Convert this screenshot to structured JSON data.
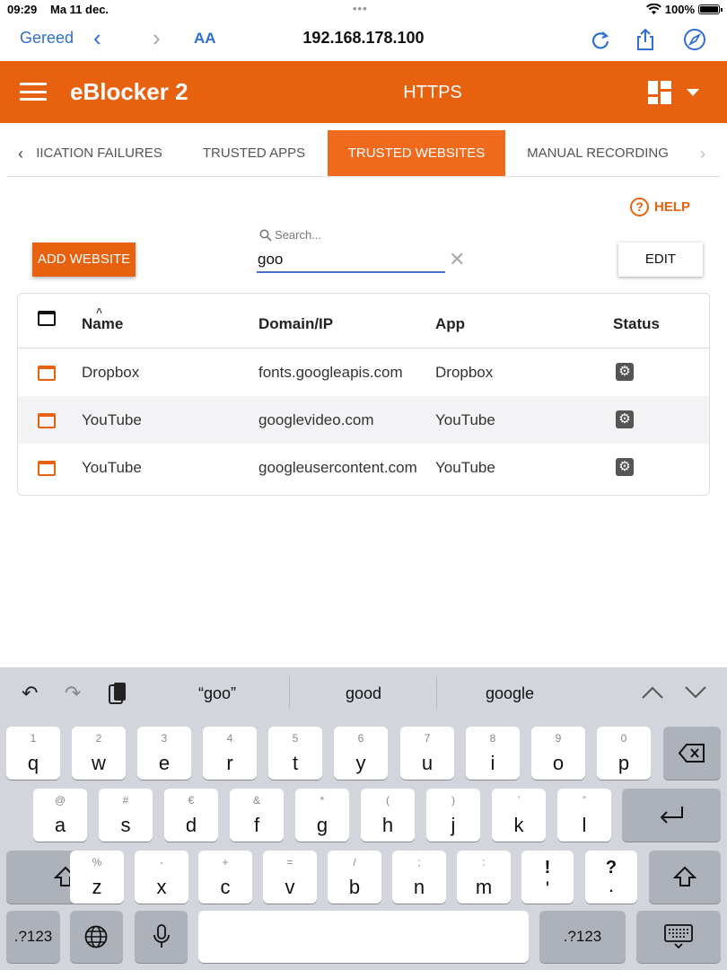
{
  "status_bar": {
    "time": "09:29",
    "date": "Ma 11 dec.",
    "battery": "100%"
  },
  "browser": {
    "done_label": "Gereed",
    "text_size_label": "AA",
    "url": "192.168.178.100"
  },
  "app": {
    "brand": "eBlocker 2",
    "page_title": "HTTPS"
  },
  "tabs": [
    {
      "label": "IICATION FAILURES",
      "active": false
    },
    {
      "label": "TRUSTED APPS",
      "active": false
    },
    {
      "label": "TRUSTED WEBSITES",
      "active": true
    },
    {
      "label": "MANUAL RECORDING",
      "active": false
    }
  ],
  "toolbar": {
    "help_label": "HELP",
    "add_label": "ADD WEBSITE",
    "search_placeholder": "Search...",
    "search_value": "goo",
    "edit_label": "EDIT"
  },
  "table": {
    "headers": {
      "name": "Name",
      "domain": "Domain/IP",
      "app": "App",
      "status": "Status"
    },
    "rows": [
      {
        "name": "Dropbox",
        "domain": "fonts.googleapis.com",
        "app": "Dropbox"
      },
      {
        "name": "YouTube",
        "domain": "googlevideo.com",
        "app": "YouTube"
      },
      {
        "name": "YouTube",
        "domain": "googleusercontent.com",
        "app": "YouTube"
      }
    ]
  },
  "keyboard": {
    "suggestions": [
      "“goo”",
      "good",
      "google"
    ],
    "row1": [
      [
        "1",
        "q"
      ],
      [
        "2",
        "w"
      ],
      [
        "3",
        "e"
      ],
      [
        "4",
        "r"
      ],
      [
        "5",
        "t"
      ],
      [
        "6",
        "y"
      ],
      [
        "7",
        "u"
      ],
      [
        "8",
        "i"
      ],
      [
        "9",
        "o"
      ],
      [
        "0",
        "p"
      ]
    ],
    "row2": [
      [
        "@",
        "a"
      ],
      [
        "#",
        "s"
      ],
      [
        "€",
        "d"
      ],
      [
        "&",
        "f"
      ],
      [
        "*",
        "g"
      ],
      [
        "(",
        "h"
      ],
      [
        ")",
        "j"
      ],
      [
        "’",
        "k"
      ],
      [
        "”",
        "l"
      ]
    ],
    "row3": [
      [
        "%",
        "z"
      ],
      [
        "-",
        "x"
      ],
      [
        "+",
        "c"
      ],
      [
        "=",
        "v"
      ],
      [
        "/",
        "b"
      ],
      [
        ";",
        "n"
      ],
      [
        ":",
        "m"
      ],
      [
        "!",
        "'"
      ],
      [
        "?",
        "."
      ]
    ],
    "numbers_label": ".?123"
  },
  "colors": {
    "accent": "#e8610f",
    "link": "#2d6fd6"
  }
}
